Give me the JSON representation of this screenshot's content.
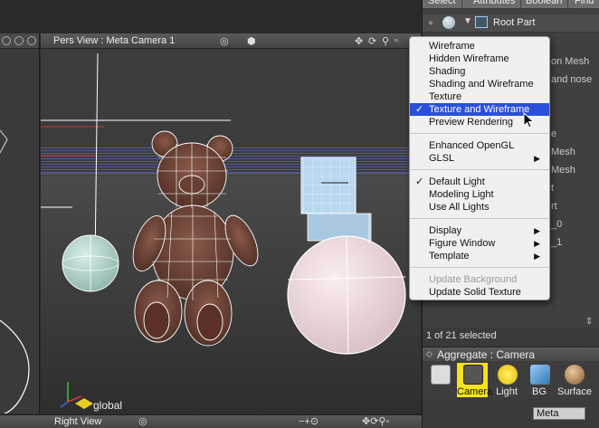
{
  "top_tabs": [
    "Select",
    "Attributes",
    "Boolean",
    "Find"
  ],
  "main_view": {
    "title": "Pers View : Meta Camera 1",
    "axis_label": "global"
  },
  "bottom_view": {
    "title": "Right View"
  },
  "tree": {
    "root": "Root Part",
    "partial_labels": [
      "on Mesh",
      "and nose",
      "e",
      "Mesh",
      "Mesh",
      "t",
      "rt",
      "_0",
      "_1"
    ]
  },
  "selection": {
    "count_text": "1 of 21 selected"
  },
  "aggregate": {
    "title": "Aggregate : Camera",
    "buttons": [
      {
        "label": "",
        "icon": "pointer-icon"
      },
      {
        "label": "Camera",
        "icon": "camera-icon"
      },
      {
        "label": "Light",
        "icon": "sun-icon"
      },
      {
        "label": "BG",
        "icon": "background-icon"
      },
      {
        "label": "Surface",
        "icon": "sphere-surface-icon"
      }
    ],
    "meta_select": "Meta"
  },
  "menu": {
    "groups": [
      [
        {
          "label": "Wireframe"
        },
        {
          "label": "Hidden Wireframe"
        },
        {
          "label": "Shading"
        },
        {
          "label": "Shading and Wireframe"
        },
        {
          "label": "Texture"
        },
        {
          "label": "Texture and Wireframe",
          "checked": true,
          "highlighted": true
        },
        {
          "label": "Preview Rendering"
        }
      ],
      [
        {
          "label": "Enhanced OpenGL"
        },
        {
          "label": "GLSL",
          "submenu": true
        }
      ],
      [
        {
          "label": "Default Light",
          "checked": true
        },
        {
          "label": "Modeling Light"
        },
        {
          "label": "Use All Lights"
        }
      ],
      [
        {
          "label": "Display",
          "submenu": true
        },
        {
          "label": "Figure Window",
          "submenu": true
        },
        {
          "label": "Template",
          "submenu": true
        }
      ],
      [
        {
          "label": "Update Background",
          "disabled": true
        },
        {
          "label": "Update Solid Texture"
        }
      ]
    ]
  },
  "colors": {
    "highlight": "#2b4fd6",
    "camera_button": "#f4e21a"
  }
}
